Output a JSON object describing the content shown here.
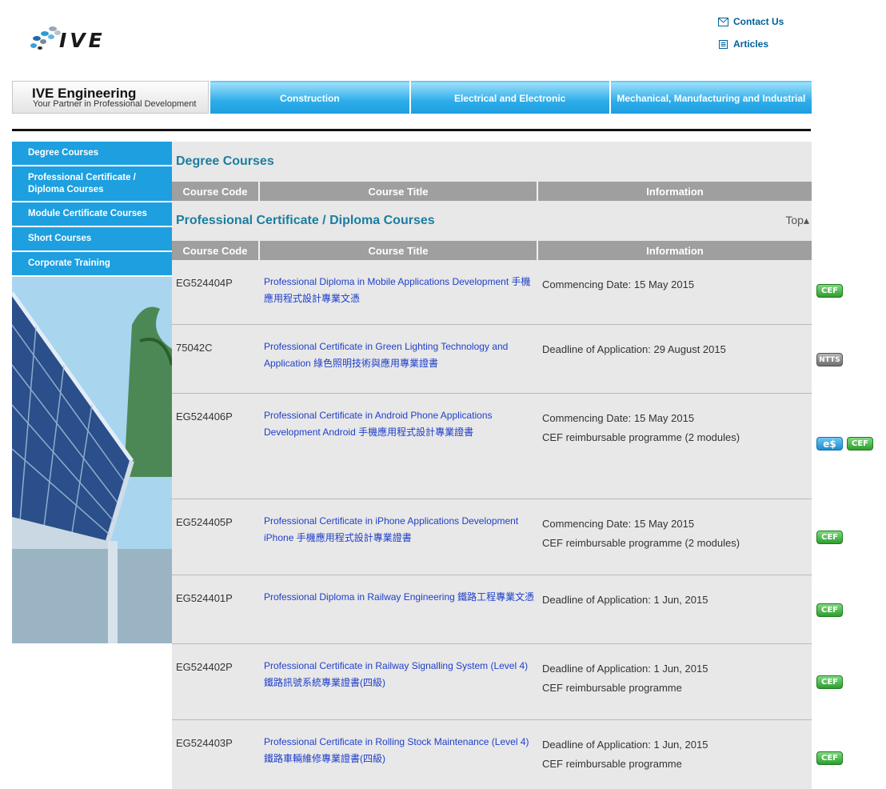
{
  "header": {
    "logo_text": "IVE",
    "links": [
      {
        "label": "Contact Us",
        "icon": "envelope-icon"
      },
      {
        "label": "Articles",
        "icon": "document-icon"
      }
    ]
  },
  "nav": {
    "brand_title": "IVE Engineering",
    "brand_subtitle": "Your Partner in Professional Development",
    "tabs": [
      "Construction",
      "Electrical and Electronic",
      "Mechanical, Manufacturing and Industrial"
    ]
  },
  "sidebar": {
    "items": [
      "Degree Courses",
      "Professional Certificate / Diploma Courses",
      "Module Certificate Courses",
      "Short Courses",
      "Corporate Training"
    ]
  },
  "sections": {
    "degree_title": "Degree Courses",
    "diploma_title": "Professional Certificate / Diploma Courses",
    "top_link": "Top▴"
  },
  "table_headers": [
    "Course Code",
    "Course Title",
    "Information"
  ],
  "courses": [
    {
      "code": "EG524404P",
      "title": "Professional Diploma in Mobile Applications Development 手機應用程式設計專業文憑",
      "info1": "Commencing Date: 15 May 2015",
      "info2": "",
      "badges": [
        "CEF"
      ]
    },
    {
      "code": "75042C",
      "title": "Professional Certificate in Green Lighting Technology and Application 綠色照明技術與應用專業證書",
      "info1": "Deadline of Application: 29 August 2015",
      "info2": "",
      "badges": [
        "NTTS"
      ]
    },
    {
      "code": "EG524406P",
      "title": "Professional Certificate in Android Phone Applications Development Android 手機應用程式設計專業證書",
      "info1": "Commencing Date: 15 May 2015",
      "info2": "CEF reimbursable programme (2 modules)",
      "badges": [
        "e$",
        "CEF"
      ]
    },
    {
      "code": "EG524405P",
      "title": "Professional Certificate in iPhone Applications Development iPhone 手機應用程式設計專業證書",
      "info1": "Commencing Date: 15 May 2015",
      "info2": "CEF reimbursable programme (2 modules)",
      "badges": [
        "CEF"
      ]
    },
    {
      "code": "EG524401P",
      "title": "Professional Diploma in Railway Engineering 鐵路工程專業文憑",
      "info1": "Deadline of Application: 1 Jun, 2015",
      "info2": "",
      "badges": [
        "CEF"
      ]
    },
    {
      "code": "EG524402P",
      "title": "Professional Certificate in Railway Signalling System (Level 4) 鐵路訊號系統專業證書(四級)",
      "info1": "Deadline of Application: 1 Jun, 2015",
      "info2": "CEF reimbursable programme",
      "badges": [
        "CEF"
      ]
    },
    {
      "code": "EG524403P",
      "title": "Professional Certificate in Rolling Stock Maintenance (Level 4) 鐵路車輛維修專業證書(四級)",
      "info1": "Deadline of Application: 1 Jun, 2015",
      "info2": "CEF reimbursable programme",
      "badges": [
        "CEF"
      ]
    }
  ]
}
